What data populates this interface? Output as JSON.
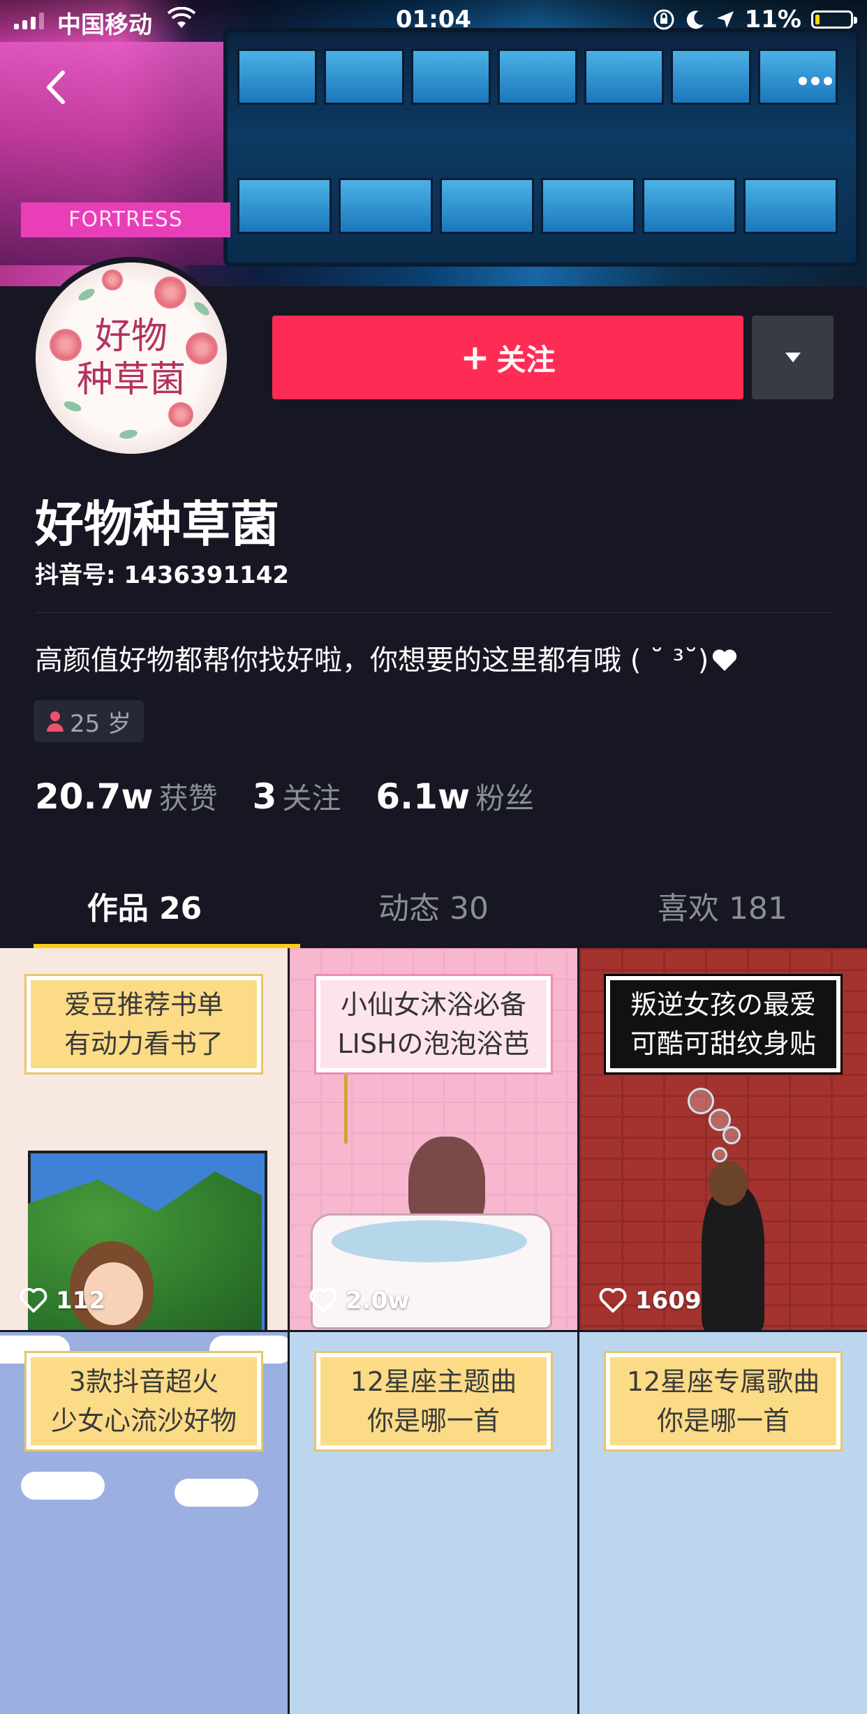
{
  "status_bar": {
    "carrier": "中国移动",
    "time": "01:04",
    "battery": "11%"
  },
  "profile": {
    "avatar_text_line1": "好物",
    "avatar_text_line2": "种草菌",
    "follow_label": "关注",
    "follow_plus": "+",
    "name": "好物种草菌",
    "douyin_id": "抖音号: 1436391142",
    "bio": "高颜值好物都帮你找好啦，你想要的这里都有哦 ( ˘ ³˘)",
    "age": "25 岁"
  },
  "stats": [
    {
      "num": "20.7w",
      "label": "获赞"
    },
    {
      "num": "3",
      "label": "关注"
    },
    {
      "num": "6.1w",
      "label": "粉丝"
    }
  ],
  "tabs": [
    {
      "label": "作品 26"
    },
    {
      "label": "动态 30"
    },
    {
      "label": "喜欢 181"
    }
  ],
  "videos": [
    {
      "line1": "爱豆推荐书单",
      "line2": "有动力看书了",
      "likes": "112"
    },
    {
      "line1": "小仙女沐浴必备",
      "line2": "LISHの泡泡浴芭",
      "likes": "2.0w"
    },
    {
      "line1": "叛逆女孩の最爱",
      "line2": "可酷可甜纹身贴",
      "likes": "1609"
    },
    {
      "line1": "3款抖音超火",
      "line2": "少女心流沙好物",
      "likes": ""
    },
    {
      "line1": "12星座主题曲",
      "line2": "你是哪一首",
      "likes": ""
    },
    {
      "line1": "12星座专属歌曲",
      "line2": "你是哪一首",
      "likes": ""
    }
  ],
  "banner": {
    "sign_text": "FORTRESS"
  },
  "colors": {
    "accent": "#fe2c55",
    "tab_indicator": "#face15",
    "background": "#161722"
  },
  "icons": [
    "back-icon",
    "more-icon",
    "dropdown-arrow-icon",
    "heart-icon",
    "person-icon",
    "wifi-icon",
    "signal-icon",
    "battery-icon",
    "location-icon",
    "moon-icon",
    "lock-rotation-icon"
  ]
}
